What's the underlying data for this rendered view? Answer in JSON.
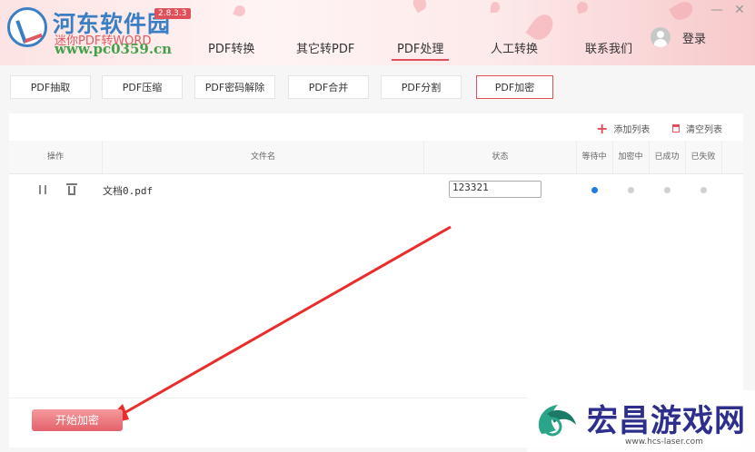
{
  "app": {
    "brand_title": "河东软件园",
    "brand_subtitle": "迷你PDF转WORD",
    "brand_url": "www.pc0359.cn",
    "version": "2.8.3.3"
  },
  "nav": {
    "tabs": [
      {
        "label": "PDF转换"
      },
      {
        "label": "其它转PDF"
      },
      {
        "label": "PDF处理"
      },
      {
        "label": "人工转换"
      },
      {
        "label": "联系我们"
      }
    ],
    "active_index": 2
  },
  "user": {
    "login_label": "登录"
  },
  "window": {
    "minimize": "—",
    "close": "✕"
  },
  "subtabs": {
    "items": [
      {
        "label": "PDF抽取"
      },
      {
        "label": "PDF压缩"
      },
      {
        "label": "PDF密码解除"
      },
      {
        "label": "PDF合并"
      },
      {
        "label": "PDF分割"
      },
      {
        "label": "PDF加密"
      }
    ],
    "active_index": 5
  },
  "toolbar": {
    "add_list": "添加列表",
    "clear_list": "清空列表"
  },
  "table": {
    "headers": [
      "操作",
      "文件名",
      "状态",
      "等待中",
      "加密中",
      "已成功",
      "已失败"
    ],
    "rows": [
      {
        "filename": "文档0.pdf",
        "password": "123321",
        "status": "等待中"
      }
    ]
  },
  "actions": {
    "start_label": "开始加密"
  },
  "watermark": {
    "text": "宏昌游戏网",
    "url": "www.hcs-laser.com"
  },
  "colors": {
    "accent": "#e0505a",
    "status_active": "#1e7ce0",
    "status_inactive": "#d0d0d0"
  }
}
